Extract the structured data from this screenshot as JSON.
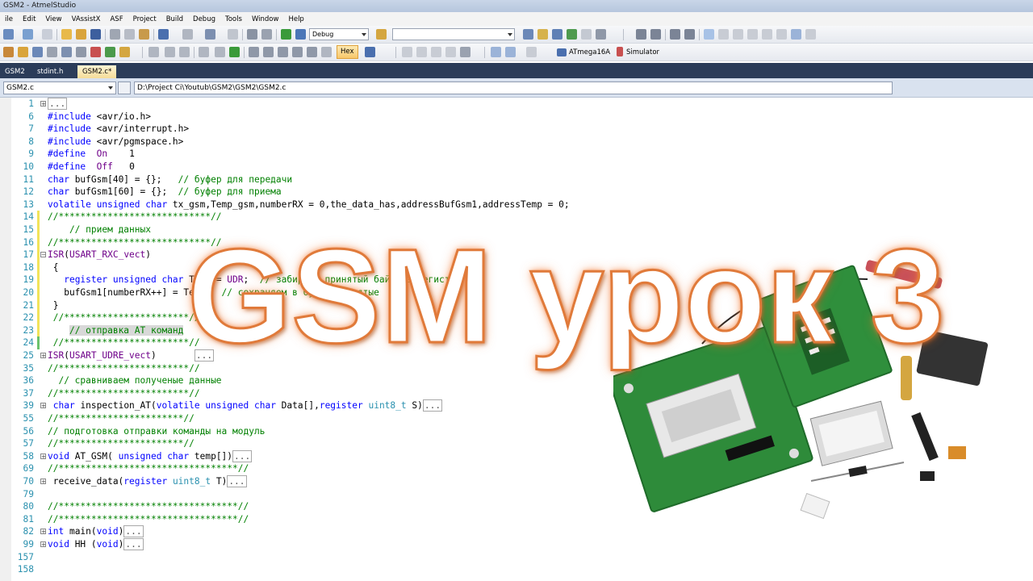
{
  "window": {
    "title": "GSM2 - AtmelStudio"
  },
  "menu": [
    "ile",
    "Edit",
    "View",
    "VAssistX",
    "ASF",
    "Project",
    "Build",
    "Debug",
    "Tools",
    "Window",
    "Help"
  ],
  "toolbar": {
    "config_value": "Debug",
    "find_value": "",
    "hex_label": "Hex",
    "device_label": "ATmega16A",
    "tool_label": "Simulator"
  },
  "tabs": [
    {
      "label": "GSM2",
      "active": false
    },
    {
      "label": "stdint.h",
      "active": false
    },
    {
      "label": "GSM2.c*",
      "active": true
    }
  ],
  "navbar": {
    "file_combo": "GSM2.c",
    "path": "D:\\Project Ci\\Youtub\\GSM2\\GSM2\\GSM2.c"
  },
  "editor": {
    "lines": [
      {
        "n": "1",
        "fold": "+",
        "html": "<span class=\"coll\">...</span>"
      },
      {
        "n": "6",
        "html": "<span class=\"pp\">#include</span> &lt;avr/io.h&gt;"
      },
      {
        "n": "7",
        "html": "<span class=\"pp\">#include</span> &lt;avr/interrupt.h&gt;"
      },
      {
        "n": "8",
        "html": "<span class=\"pp\">#include</span> &lt;avr/pgmspace.h&gt;"
      },
      {
        "n": "9",
        "html": "<span class=\"pp\">#define</span>  <span class=\"mc\">On</span>    1"
      },
      {
        "n": "10",
        "html": "<span class=\"pp\">#define</span>  <span class=\"mc\">Off</span>   0"
      },
      {
        "n": "11",
        "html": "<span class=\"kw\">char</span> bufGsm[40] = {};   <span class=\"cm\">// буфер для передачи</span>"
      },
      {
        "n": "12",
        "html": "<span class=\"kw\">char</span> bufGsm1[60] = {};  <span class=\"cm\">// буфер для приема</span>"
      },
      {
        "n": "13",
        "html": "<span class=\"kw\">volatile unsigned char</span> tx_gsm,Temp_gsm,numberRX = 0,the_data_has,addressBufGsm1,addressTemp = 0;"
      },
      {
        "n": "14",
        "chg": "y",
        "html": "<span class=\"cm\">//****************************//</span>"
      },
      {
        "n": "15",
        "chg": "y",
        "html": "<span class=\"cm\">    // прием данных</span>"
      },
      {
        "n": "16",
        "chg": "y",
        "html": "<span class=\"cm\">//****************************//</span>"
      },
      {
        "n": "17",
        "chg": "y",
        "fold": "-",
        "html": "<span class=\"mc\">ISR</span>(<span class=\"mc\">USART_RXC_vect</span>)"
      },
      {
        "n": "18",
        "chg": "y",
        "html": " {"
      },
      {
        "n": "19",
        "chg": "y",
        "html": "   <span class=\"kw\">register unsigned char</span> Temp = <span class=\"mc\">UDR</span>;  <span class=\"cm\">// забираем принятый байт из регистра</span>"
      },
      {
        "n": "20",
        "chg": "y",
        "html": "   bufGsm1[numberRX++] = Temp;  <span class=\"cm\">// сохраняем в буфер принятые</span>"
      },
      {
        "n": "21",
        "chg": "y",
        "html": " }"
      },
      {
        "n": "22",
        "chg": "y",
        "html": " <span class=\"cm\">//***********************//</span>"
      },
      {
        "n": "23",
        "chg": "y",
        "html": "    <span class=\"cm hl\">// отправка AT команд</span>"
      },
      {
        "n": "24",
        "chg": "g",
        "html": " <span class=\"cm\">//***********************//</span>"
      },
      {
        "n": "25",
        "fold": "+",
        "html": "<span class=\"mc\">ISR</span>(<span class=\"mc\">USART_UDRE_vect</span>)       <span class=\"coll\">...</span>"
      },
      {
        "n": "35",
        "html": "<span class=\"cm\">//************************//</span>"
      },
      {
        "n": "36",
        "html": "<span class=\"cm\">  // сравниваем полученые данные</span>"
      },
      {
        "n": "37",
        "html": "<span class=\"cm\">//************************//</span>"
      },
      {
        "n": "39",
        "fold": "+",
        "html": " <span class=\"kw\">char</span> inspection_AT(<span class=\"kw\">volatile unsigned char</span> Data[],<span class=\"kw\">register</span> <span class=\"ty\">uint8_t</span> S)<span class=\"coll\">...</span>"
      },
      {
        "n": "55",
        "html": "<span class=\"cm\">//***********************//</span>"
      },
      {
        "n": "56",
        "html": "<span class=\"cm\">// подготовка отправки команды на модуль</span>"
      },
      {
        "n": "57",
        "html": "<span class=\"cm\">//***********************//</span>"
      },
      {
        "n": "58",
        "fold": "+",
        "html": "<span class=\"kw\">void</span> AT_GSM( <span class=\"kw\">unsigned char</span> temp[])<span class=\"coll\">...</span>"
      },
      {
        "n": "69",
        "html": "<span class=\"cm\">//*********************************//</span>"
      },
      {
        "n": "70",
        "fold": "+",
        "html": " receive_data(<span class=\"kw\">register</span> <span class=\"ty\">uint8_t</span> T)<span class=\"coll\">...</span>"
      },
      {
        "n": "79",
        "html": ""
      },
      {
        "n": "80",
        "html": "<span class=\"cm\">//*********************************//</span>"
      },
      {
        "n": "81",
        "html": "<span class=\"cm\">//*********************************//</span>"
      },
      {
        "n": "82",
        "fold": "+",
        "html": "<span class=\"kw\">int</span> main(<span class=\"kw\">void</span>)<span class=\"coll\">...</span>"
      },
      {
        "n": "99",
        "fold": "+",
        "html": "<span class=\"kw\">void</span> HH (<span class=\"kw\">void</span>)<span class=\"coll\">...</span>"
      },
      {
        "n": "157",
        "html": ""
      },
      {
        "n": "158",
        "html": ""
      }
    ]
  },
  "overlay": {
    "title": "GSM урок 3",
    "color": "#e07a3a"
  },
  "colors": {
    "tab_strip": "#2b3c59",
    "active_tab": "#f5dc98",
    "keyword": "#0000ff",
    "comment": "#008000",
    "line_number": "#2b91af"
  }
}
